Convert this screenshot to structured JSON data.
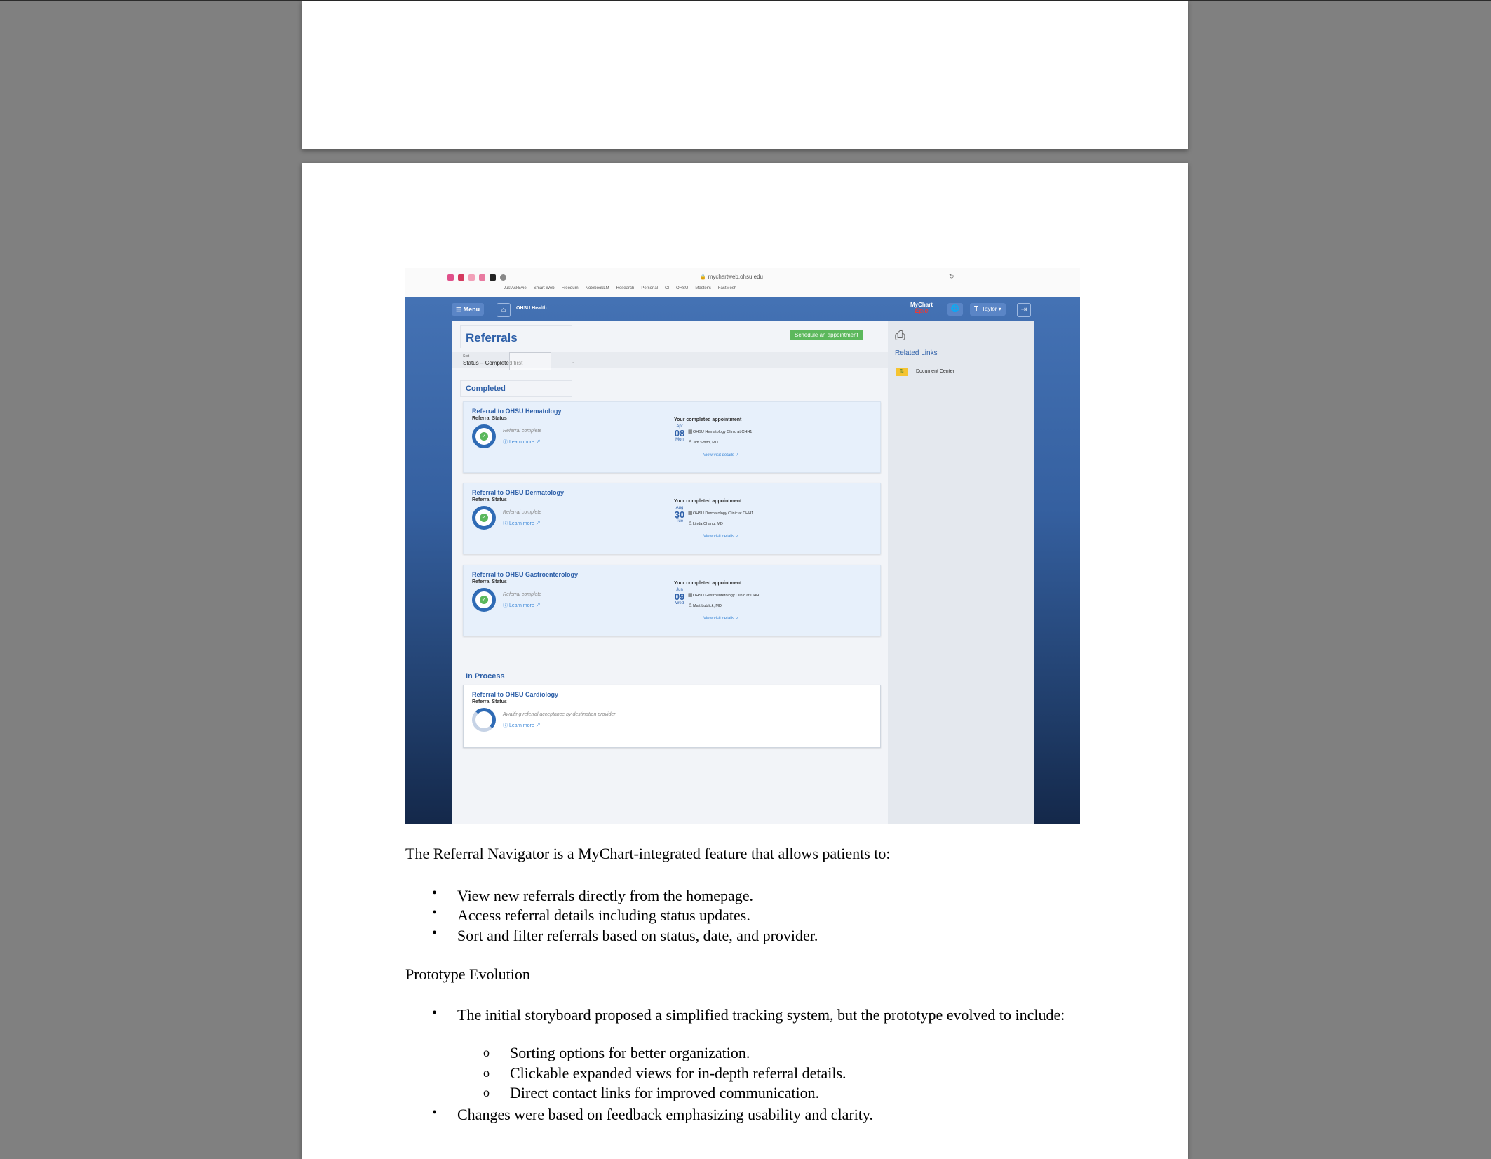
{
  "screenshot": {
    "browser": {
      "url": "mychartweb.ohsu.edu",
      "bookmarks": [
        "JustAskEvie",
        "Smart Web",
        "Freedum",
        "NotebookLM",
        "Research",
        "Personal",
        "CI",
        "OHSU",
        "Master's",
        "FastMesh"
      ]
    },
    "appbar": {
      "menu_label": "Menu",
      "brand": "OHSU Health",
      "mychart_logo": "MyChart",
      "mychart_by": "Epic",
      "user_initial": "T",
      "user_name": "Taylor"
    },
    "main": {
      "title": "Referrals",
      "schedule_button": "Schedule an appointment",
      "sort_caption": "Sort",
      "sort_value": "Status – Completed first",
      "completed_heading": "Completed",
      "in_process_heading": "In Process",
      "completed_referrals": [
        {
          "title": "Referral to OHSU Hematology",
          "status_label": "Referral Status",
          "status": "Referral complete",
          "learn_more": "Learn more",
          "appt_heading": "Your completed appointment",
          "month": "Apr",
          "day": "08",
          "weekday": "Mon",
          "clinic": "OHSU Hematology Clinic at CHH1",
          "provider": "Jim Smith, MD",
          "view_details": "View visit details"
        },
        {
          "title": "Referral to OHSU Dermatology",
          "status_label": "Referral Status",
          "status": "Referral complete",
          "learn_more": "Learn more",
          "appt_heading": "Your completed appointment",
          "month": "Aug",
          "day": "30",
          "weekday": "Tue",
          "clinic": "OHSU Dermatology Clinic at CHH1",
          "provider": "Linda Chang, MD",
          "view_details": "View visit details"
        },
        {
          "title": "Referral to OHSU Gastroenterology",
          "status_label": "Referral Status",
          "status": "Referral complete",
          "learn_more": "Learn more",
          "appt_heading": "Your completed appointment",
          "month": "Jun",
          "day": "09",
          "weekday": "Wed",
          "clinic": "OHSU Gastroenterology Clinic at CHH1",
          "provider": "Matt Lublick, MD",
          "view_details": "View visit details"
        }
      ],
      "in_process_referral": {
        "title": "Referral to OHSU Cardiology",
        "status_label": "Referral Status",
        "status": "Awaiting referral acceptance by destination provider",
        "learn_more": "Learn more"
      }
    },
    "sidebar": {
      "related_links": "Related Links",
      "document_center": "Document Center"
    }
  },
  "document": {
    "intro": "The Referral Navigator is a MyChart-integrated feature that allows patients to:",
    "features": [
      "View new referrals directly from the homepage.",
      "Access referral details including status updates.",
      "Sort and filter referrals based on status, date, and provider."
    ],
    "section_title": "Prototype Evolution",
    "evolution_lead": "The initial storyboard proposed a simplified tracking system, but the prototype evolved to include:",
    "evolution_sub": [
      "Sorting options for better organization.",
      "Clickable expanded views for in-depth referral details.",
      "Direct contact links for improved communication."
    ],
    "evolution_last": "Changes were based on feedback emphasizing usability and clarity.",
    "bullet_symbol": "•",
    "sub_bullet_symbol": "o"
  }
}
